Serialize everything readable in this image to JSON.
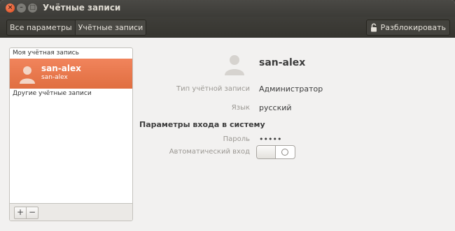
{
  "window": {
    "title": "Учётные записи",
    "buttons": {
      "close": "×",
      "minimize": "–",
      "maximize": "□"
    }
  },
  "toolbar": {
    "breadcrumbs": [
      "Все параметры",
      "Учётные записи"
    ],
    "unlock_label": "Разблокировать",
    "unlock_icon": "lock-icon"
  },
  "sidebar": {
    "my_account_label": "Моя учётная запись",
    "selected_user": {
      "name": "san-alex",
      "login": "san-alex"
    },
    "other_accounts_label": "Другие учётные записи",
    "add_label": "+",
    "remove_label": "−"
  },
  "details": {
    "user_name": "san-alex",
    "account_type": {
      "label": "Тип учётной записи",
      "value": "Администратор"
    },
    "language": {
      "label": "Язык",
      "value": "русский"
    },
    "login_section_heading": "Параметры входа в систему",
    "password": {
      "label": "Пароль",
      "value": "•••••"
    },
    "auto_login": {
      "label": "Автоматический вход",
      "on": false
    }
  },
  "colors": {
    "accent": "#e8774a",
    "titlebar": "#3c3b37",
    "window_bg": "#f2f1f0"
  }
}
